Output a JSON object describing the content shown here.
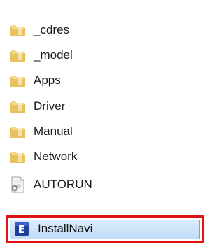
{
  "file_list": {
    "items": [
      {
        "name": "_cdres",
        "type": "folder",
        "icon": "folder-icon"
      },
      {
        "name": "_model",
        "type": "folder",
        "icon": "folder-icon"
      },
      {
        "name": "Apps",
        "type": "folder",
        "icon": "folder-icon"
      },
      {
        "name": "Driver",
        "type": "folder",
        "icon": "folder-icon"
      },
      {
        "name": "Manual",
        "type": "folder",
        "icon": "folder-icon"
      },
      {
        "name": "Network",
        "type": "folder",
        "icon": "folder-icon"
      },
      {
        "name": "AUTORUN",
        "type": "file",
        "icon": "settings-file-icon"
      },
      {
        "name": "InstallNavi",
        "type": "application",
        "icon": "app-icon",
        "selected": true
      }
    ]
  },
  "colors": {
    "highlight_border": "#e01414",
    "selection_fill": "#c1dcf9",
    "folder": "#e8c25a"
  }
}
